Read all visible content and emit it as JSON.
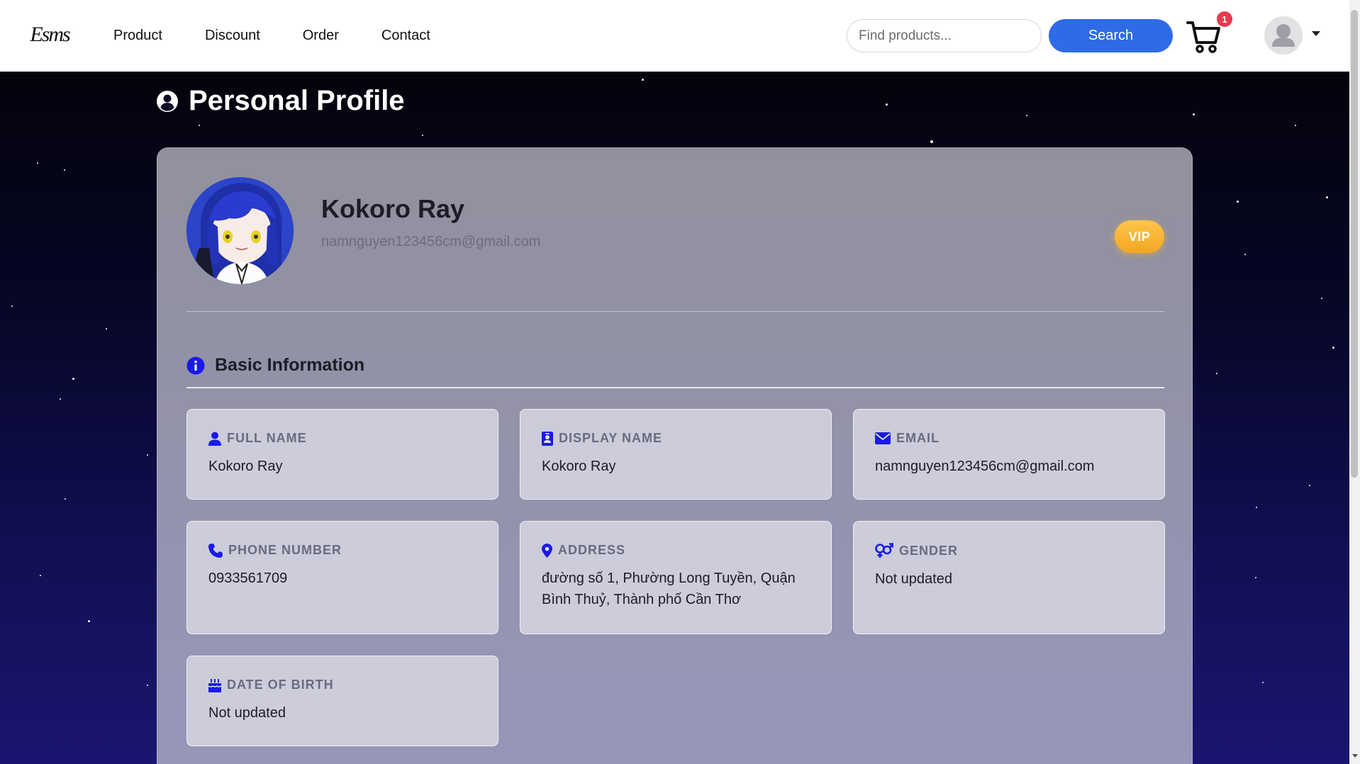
{
  "navbar": {
    "logo_text": "Esms",
    "links": [
      "Product",
      "Discount",
      "Order",
      "Contact"
    ],
    "search_placeholder": "Find products...",
    "search_label": "Search",
    "cart_count": "1"
  },
  "page": {
    "title": "Personal Profile"
  },
  "profile": {
    "name": "Kokoro Ray",
    "email": "namnguyen123456cm@gmail.com",
    "badge": "VIP"
  },
  "basic_info": {
    "title": "Basic Information",
    "fields": [
      {
        "label": "FULL NAME",
        "value": "Kokoro Ray",
        "icon": "user-icon"
      },
      {
        "label": "DISPLAY NAME",
        "value": "Kokoro Ray",
        "icon": "id-badge-icon"
      },
      {
        "label": "EMAIL",
        "value": "namnguyen123456cm@gmail.com",
        "icon": "envelope-icon"
      },
      {
        "label": "PHONE NUMBER",
        "value": "0933561709",
        "icon": "phone-icon"
      },
      {
        "label": "ADDRESS",
        "value": "đường số 1, Phường Long Tuyền, Quận Bình Thuỷ, Thành phố Cần Thơ",
        "icon": "map-pin-icon"
      },
      {
        "label": "GENDER",
        "value": "Not updated",
        "icon": "gender-icon"
      },
      {
        "label": "DATE OF BIRTH",
        "value": "Not updated",
        "icon": "birthday-cake-icon"
      }
    ]
  },
  "colors": {
    "accent": "#2f6be6",
    "icon_blue": "#1a1ae6",
    "vip": "#f5b12f",
    "badge_red": "#e63a4d"
  }
}
